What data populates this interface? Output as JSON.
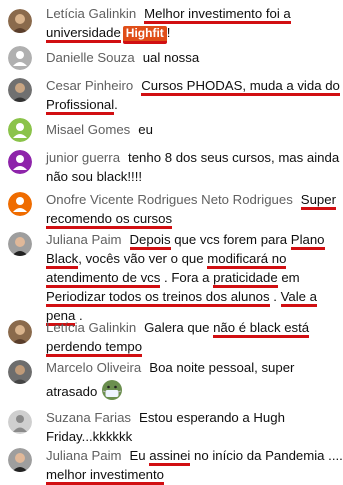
{
  "comments": [
    {
      "author": "Letícia Galinkin",
      "l1": [
        "Melhor investimento foi a"
      ],
      "l2": [
        "universidade",
        "Highfit",
        "!"
      ],
      "avatar": "woman-curly-photo"
    },
    {
      "author": "Danielle Souza",
      "l1": [
        "ual nossa"
      ],
      "avatar": "default-gray-avatar"
    },
    {
      "author": "Cesar Pinheiro",
      "l1": [
        "Cursos PHODAS, muda a vida do"
      ],
      "l2": [
        "Profissional",
        "."
      ],
      "avatar": "man-photo"
    },
    {
      "author": "Misael Gomes",
      "l1": [
        "eu"
      ],
      "avatar": "default-green-avatar"
    },
    {
      "author": "junior guerra",
      "l1": [
        "tenho 8 dos seus cursos, mas ainda"
      ],
      "l2": [
        "não sou black!!!!"
      ],
      "avatar": "default-purple-avatar"
    },
    {
      "author": "Onofre Vicente Rodrigues Neto Rodrigues",
      "l1": [
        "Super"
      ],
      "l2": [
        "recomendo os cursos"
      ],
      "avatar": "default-orange-avatar"
    },
    {
      "author": "Juliana Paim",
      "l1": [
        "Depois",
        " que vcs forem para ",
        "Plano"
      ],
      "l2": [
        "Black",
        ", vocês vão ver o que ",
        "modificará no"
      ],
      "l3": [
        "atendimento de vcs",
        " . Fora a ",
        "praticidade",
        " em"
      ],
      "l4": [
        "Periodizar todos os treinos dos alunos",
        " . ",
        "Vale a"
      ],
      "l5": [
        "pena",
        " ."
      ],
      "avatar": "woman-photo"
    },
    {
      "author": "Letícia Galinkin",
      "l1": [
        "Galera que ",
        "não é black está"
      ],
      "l2": [
        "perdendo tempo"
      ],
      "avatar": "woman-curly-photo"
    },
    {
      "author": "Marcelo Oliveira",
      "l1": [
        "Boa noite pessoal, super"
      ],
      "l2": [
        "atrasado"
      ],
      "emoji": "face-with-mask-emoji",
      "avatar": "man-photo-2"
    },
    {
      "author": "Suzana Farias",
      "l1": [
        "Estou esperando a Hugh"
      ],
      "l2": [
        "Friday...kkkkkk"
      ],
      "avatar": "default-silhouette-avatar"
    },
    {
      "author": "Juliana Paim",
      "l1": [
        "Eu ",
        "assinei",
        " no início da Pandemia ...."
      ],
      "l2": [
        "melhor investimento"
      ],
      "avatar": "woman-photo"
    }
  ],
  "colors": {
    "underline": "#d10f12",
    "badge": "#e04e18",
    "author": "#606060"
  }
}
